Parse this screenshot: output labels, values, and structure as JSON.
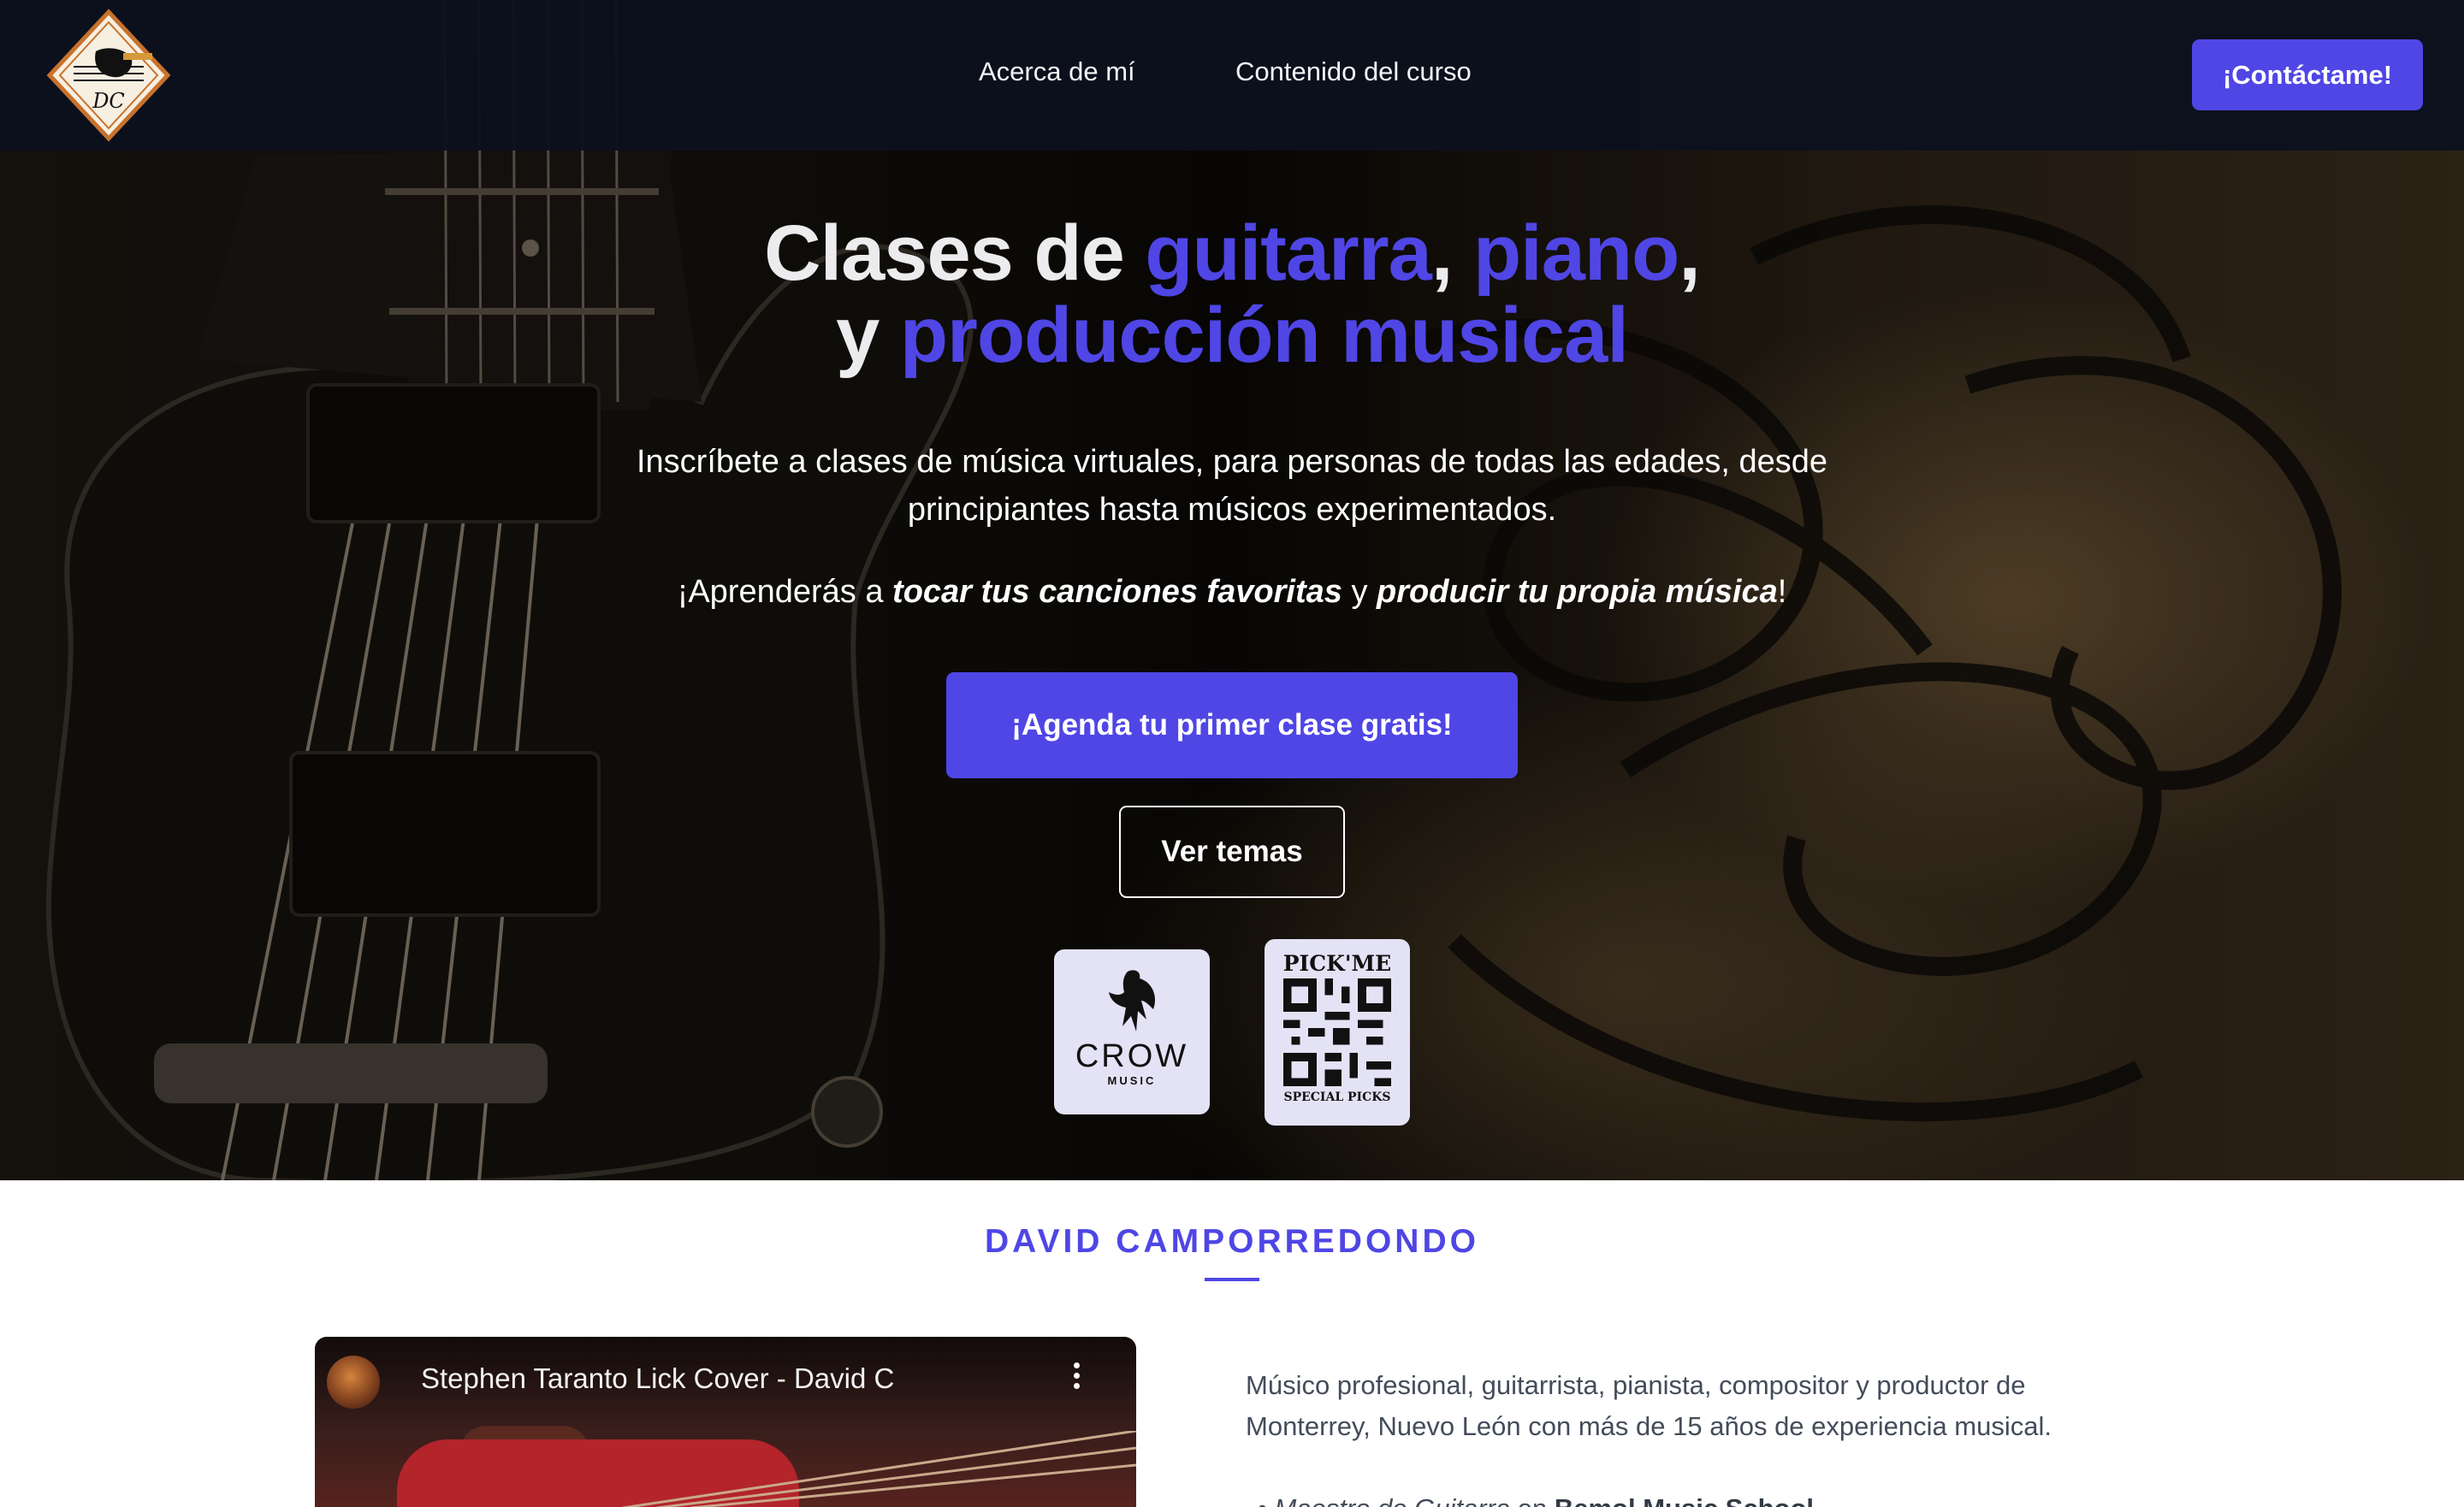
{
  "nav": {
    "logo_text": "DC",
    "links": [
      "Acerca de mí",
      "Contenido del curso"
    ],
    "contact_label": "¡Contáctame!"
  },
  "hero": {
    "headline": {
      "line1_prefix": "Clases de ",
      "line1_accent1": "guitarra",
      "line1_sep": ", ",
      "line1_accent2": "piano",
      "line1_suffix": ",",
      "line2_prefix": "y ",
      "line2_accent": "producción musical"
    },
    "lead": "Inscríbete a clases de música virtuales, para personas de todas las edades, desde principiantes hasta músicos experimentados.",
    "sub": {
      "part1": "¡Aprenderás a ",
      "em1": "tocar tus canciones favoritas",
      "part2": " y ",
      "em2": "producir tu propia música",
      "part3": "!"
    },
    "cta_label": "¡Agenda tu primer clase gratis!",
    "topics_label": "Ver temas",
    "brands": {
      "crow": {
        "word": "CROW",
        "sub": "MUSIC"
      },
      "pick": {
        "title": "PICK'ME",
        "sub": "SPECIAL PICKS"
      }
    }
  },
  "about": {
    "title": "DAVID CAMPORREDONDO",
    "video_title": "Stephen Taranto Lick Cover - David C",
    "bio": "Músico profesional, guitarrista, pianista, compositor y productor de Monterrey, Nuevo León con más de 15 años de experiencia musical.",
    "list_item": {
      "role": "Maestro de Guitarra",
      "connector": " en ",
      "place": "Bemol Music School"
    }
  },
  "colors": {
    "accent": "#4f46e5",
    "nav_bg": "#0d111e",
    "body_text": "#444c5a"
  },
  "icons": [
    "logo-guitar-icon",
    "crow-bird-icon",
    "qr-code-icon",
    "video-menu-icon"
  ]
}
